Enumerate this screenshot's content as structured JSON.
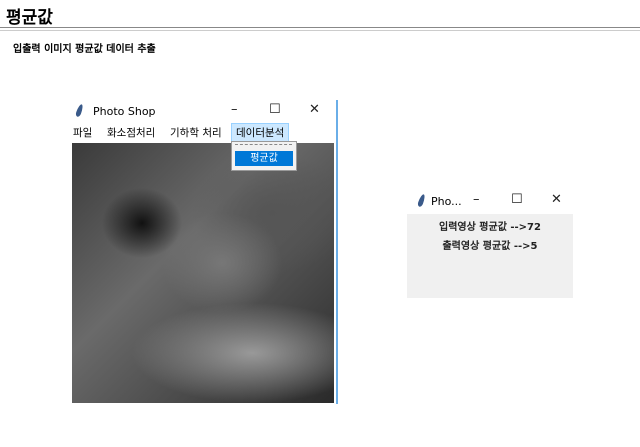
{
  "page": {
    "title": "평균값",
    "subtitle": "입출력 이미지 평균값 데이터 추출"
  },
  "main_window": {
    "title": "Photo Shop",
    "menu": [
      "파일",
      "화소점처리",
      "기하학 처리",
      "데이터분석"
    ],
    "dropdown_item": "평균값",
    "photo_alt": "dog"
  },
  "result_window": {
    "title": "Pho...",
    "lines": [
      "입력영상 평균값 -->72",
      "출력영상 평균값 -->5"
    ]
  },
  "controls": {
    "minimize": "–",
    "maximize": "☐",
    "close": "✕"
  }
}
